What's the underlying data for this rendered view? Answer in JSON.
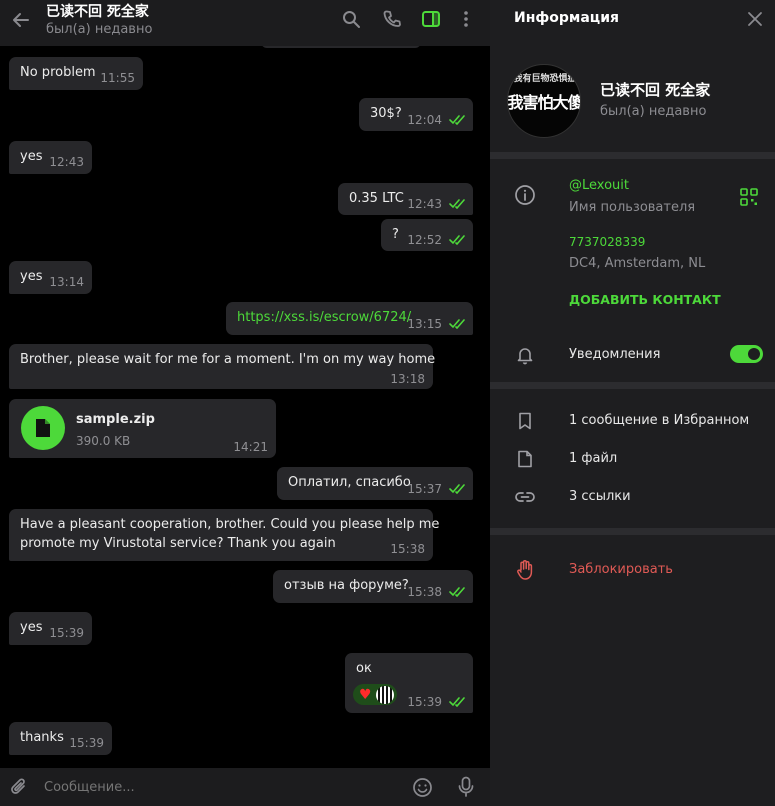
{
  "chat": {
    "title": "已读不回 死全家",
    "status": "был(а) недавно",
    "messages": [
      {
        "dir": "in",
        "text": "No problem",
        "time": "11:55"
      },
      {
        "dir": "out",
        "text": "30$?",
        "time": "12:04"
      },
      {
        "dir": "in",
        "text": "yes",
        "time": "12:43"
      },
      {
        "dir": "out",
        "text": "0.35 LTC",
        "time": "12:43"
      },
      {
        "dir": "out",
        "text": "?",
        "time": "12:52"
      },
      {
        "dir": "in",
        "text": "yes",
        "time": "13:14"
      },
      {
        "dir": "out",
        "text": "https://xss.is/escrow/6724/",
        "time": "13:15"
      },
      {
        "dir": "in",
        "text": "Brother, please wait for me for a moment. I'm on my way home",
        "time": "13:18"
      },
      {
        "dir": "in",
        "file_name": "sample.zip",
        "file_size": "390.0 KB",
        "time": "14:21"
      },
      {
        "dir": "out",
        "text": "Оплатил, спасибо",
        "time": "15:37"
      },
      {
        "dir": "in",
        "text_line1": "Have a pleasant cooperation, brother. Could you please help me",
        "text_line2": "promote my Virustotal service? Thank you again",
        "time": "15:38"
      },
      {
        "dir": "out",
        "text": "отзыв на форуме?",
        "time": "15:38"
      },
      {
        "dir": "in",
        "text": "yes",
        "time": "15:39"
      },
      {
        "dir": "out",
        "text": "ок",
        "reaction": "♥",
        "time": "15:39"
      },
      {
        "dir": "in",
        "text": "thanks",
        "time": "15:39"
      }
    ],
    "composer_placeholder": "Сообщение..."
  },
  "info": {
    "header": "Информация",
    "name": "已读不回 死全家",
    "status": "был(а) недавно",
    "avatar_text_top": "我有巨物恐惧症",
    "avatar_text_main": "我害怕大傻",
    "username": "@Lexouit",
    "username_label": "Имя пользователя",
    "phone": "7737028339",
    "dc": "DC4, Amsterdam, NL",
    "add_contact": "ДОБАВИТЬ КОНТАКТ",
    "notifications": "Уведомления",
    "notifications_on": true,
    "saved": "1 сообщение в Избранном",
    "files": "1 файл",
    "links": "3 ссылки",
    "block": "Заблокировать"
  },
  "colors": {
    "accent": "#4dd93a",
    "danger": "#e05a55",
    "bubble": "#27272a",
    "panel": "#1e1e20"
  }
}
